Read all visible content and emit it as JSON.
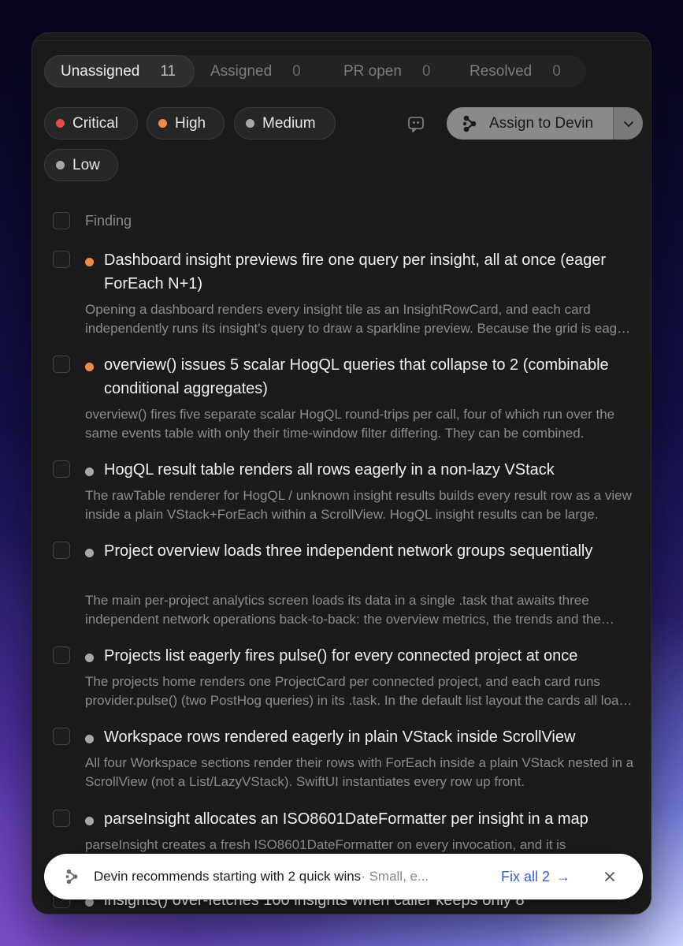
{
  "tabs": [
    {
      "label": "Unassigned",
      "count": "11"
    },
    {
      "label": "Assigned",
      "count": "0"
    },
    {
      "label": "PR open",
      "count": "0"
    },
    {
      "label": "Resolved",
      "count": "0"
    }
  ],
  "filters": [
    {
      "label": "Critical",
      "color": "#e5484d"
    },
    {
      "label": "High",
      "color": "#f08a4b"
    },
    {
      "label": "Medium",
      "color": "#a8a8a8"
    },
    {
      "label": "Low",
      "color": "#a8a8a8"
    }
  ],
  "assign_button": {
    "label": "Assign to Devin"
  },
  "list": {
    "header": "Finding",
    "items": [
      {
        "title": "Dashboard insight previews fire one query per insight, all at once (eager ForEach N+1)",
        "severity_color": "#f08a4b",
        "description": "Opening a dashboard renders every insight tile as an InsightRowCard, and each card independently runs its insight's query to draw a sparkline preview. Because the grid is eager, every card runs at once."
      },
      {
        "title": "overview() issues 5 scalar HogQL queries that collapse to 2 (combinable conditional aggregates)",
        "severity_color": "#f08a4b",
        "description": "overview() fires five separate scalar HogQL round-trips per call, four of which run over the same events table with only their time-window filter differing. They can be combined."
      },
      {
        "title": "HogQL result table renders all rows eagerly in a non-lazy VStack",
        "severity_color": "#a8a8a8",
        "description": "The rawTable renderer for HogQL / unknown insight results builds every result row as a view inside a plain VStack+ForEach within a ScrollView. HogQL insight results can be large."
      },
      {
        "title": "Project overview loads three independent network groups sequentially",
        "severity_color": "#a8a8a8",
        "description": "The main per-project analytics screen loads its data in a single .task that awaits three independent network operations back-to-back: the overview metrics, the trends and the events."
      },
      {
        "title": "Projects list eagerly fires pulse() for every connected project at once",
        "severity_color": "#a8a8a8",
        "description": "The projects home renders one ProjectCard per connected project, and each card runs provider.pulse() (two PostHog queries) in its .task. In the default list layout the cards all load at once."
      },
      {
        "title": "Workspace rows rendered eagerly in plain VStack inside ScrollView",
        "severity_color": "#a8a8a8",
        "description": "All four Workspace sections render their rows with ForEach inside a plain VStack nested in a ScrollView (not a List/LazyVStack). SwiftUI instantiates every row up front."
      },
      {
        "title": "parseInsight allocates an ISO8601DateFormatter per insight in a map",
        "severity_color": "#a8a8a8",
        "description": "parseInsight creates a fresh ISO8601DateFormatter on every invocation, and it is"
      },
      {
        "title": "insights() over-fetches 100 insights when caller keeps only 8",
        "severity_color": "#a8a8a8",
        "description": ""
      }
    ]
  },
  "toast": {
    "text": "Devin recommends starting with 2 quick wins",
    "sub": " · Small, e...",
    "action": "Fix all 2",
    "action_arrow": "→"
  }
}
